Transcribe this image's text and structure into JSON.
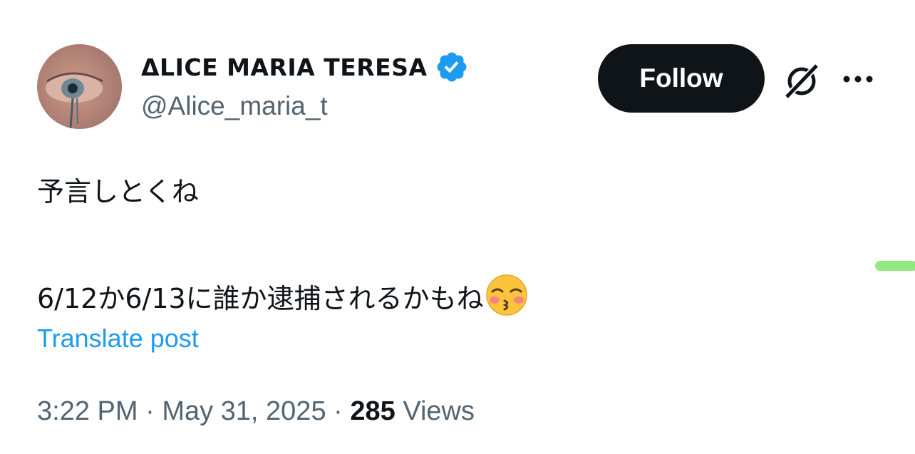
{
  "author": {
    "display_name": "ΔLICE MARIA TERESA",
    "handle": "@Alice_maria_t",
    "verified": true,
    "verified_icon": "verified-badge-icon"
  },
  "actions": {
    "follow_label": "Follow",
    "grok_icon": "grok-icon",
    "more_icon": "more-options-icon"
  },
  "tweet": {
    "line1": "予言しとくね",
    "line2": "6/12か6/13に誰か逮捕されるかもね",
    "emoji": "kissing-face-with-closed-eyes-emoji"
  },
  "translate_label": "Translate post",
  "meta": {
    "time": "3:22 PM",
    "separator": " · ",
    "date": "May 31, 2025",
    "views_count": "285",
    "views_label": " Views"
  },
  "colors": {
    "accent": "#1d9bf0",
    "text": "#0f1419",
    "secondary": "#536471",
    "button_bg": "#0f1419"
  }
}
